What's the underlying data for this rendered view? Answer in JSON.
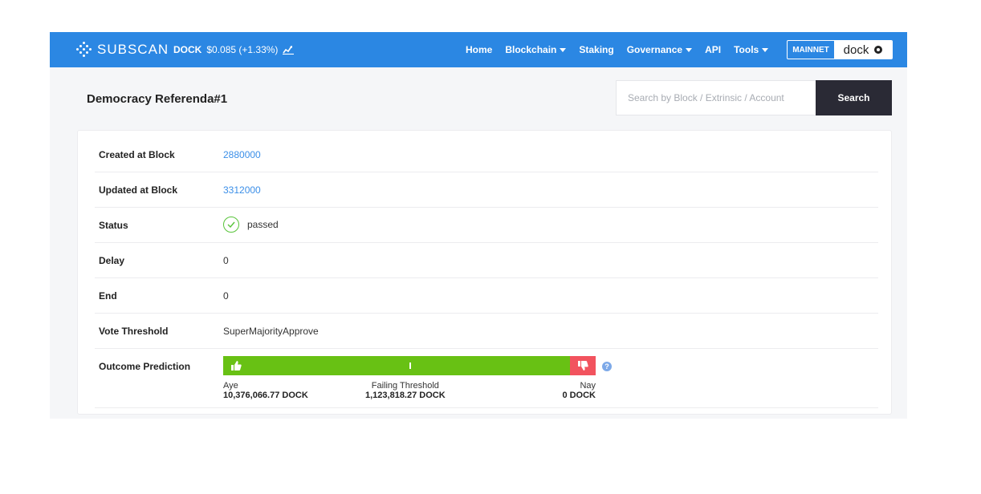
{
  "navbar": {
    "brand": "SUBSCAN",
    "token_symbol": "DOCK",
    "token_price": "$0.085 (+1.33%)",
    "links": [
      {
        "label": "Home",
        "dropdown": false
      },
      {
        "label": "Blockchain",
        "dropdown": true
      },
      {
        "label": "Staking",
        "dropdown": false
      },
      {
        "label": "Governance",
        "dropdown": true
      },
      {
        "label": "API",
        "dropdown": false
      },
      {
        "label": "Tools",
        "dropdown": true
      }
    ],
    "network_label": "MAINNET",
    "network_brand": "dock",
    "accent_color": "#2b87e3"
  },
  "header": {
    "title": "Democracy Referenda#1"
  },
  "search": {
    "placeholder": "Search by Block / Extrinsic / Account",
    "button_label": "Search"
  },
  "details": {
    "created_label": "Created at Block",
    "created_value": "2880000",
    "updated_label": "Updated at Block",
    "updated_value": "3312000",
    "status_label": "Status",
    "status_value": "passed",
    "delay_label": "Delay",
    "delay_value": "0",
    "end_label": "End",
    "end_value": "0",
    "threshold_label": "Vote Threshold",
    "threshold_value": "SuperMajorityApprove",
    "outcome_label": "Outcome Prediction"
  },
  "outcome": {
    "aye_label": "Aye",
    "aye_amount": "10,376,066.77 DOCK",
    "failing_label": "Failing Threshold",
    "failing_amount": "1,123,818.27 DOCK",
    "nay_label": "Nay",
    "nay_amount": "0 DOCK",
    "aye_fraction": 0.93,
    "threshold_fraction": 0.5,
    "aye_color": "#68c114",
    "nay_color": "#f2535e",
    "help_icon": "?"
  }
}
